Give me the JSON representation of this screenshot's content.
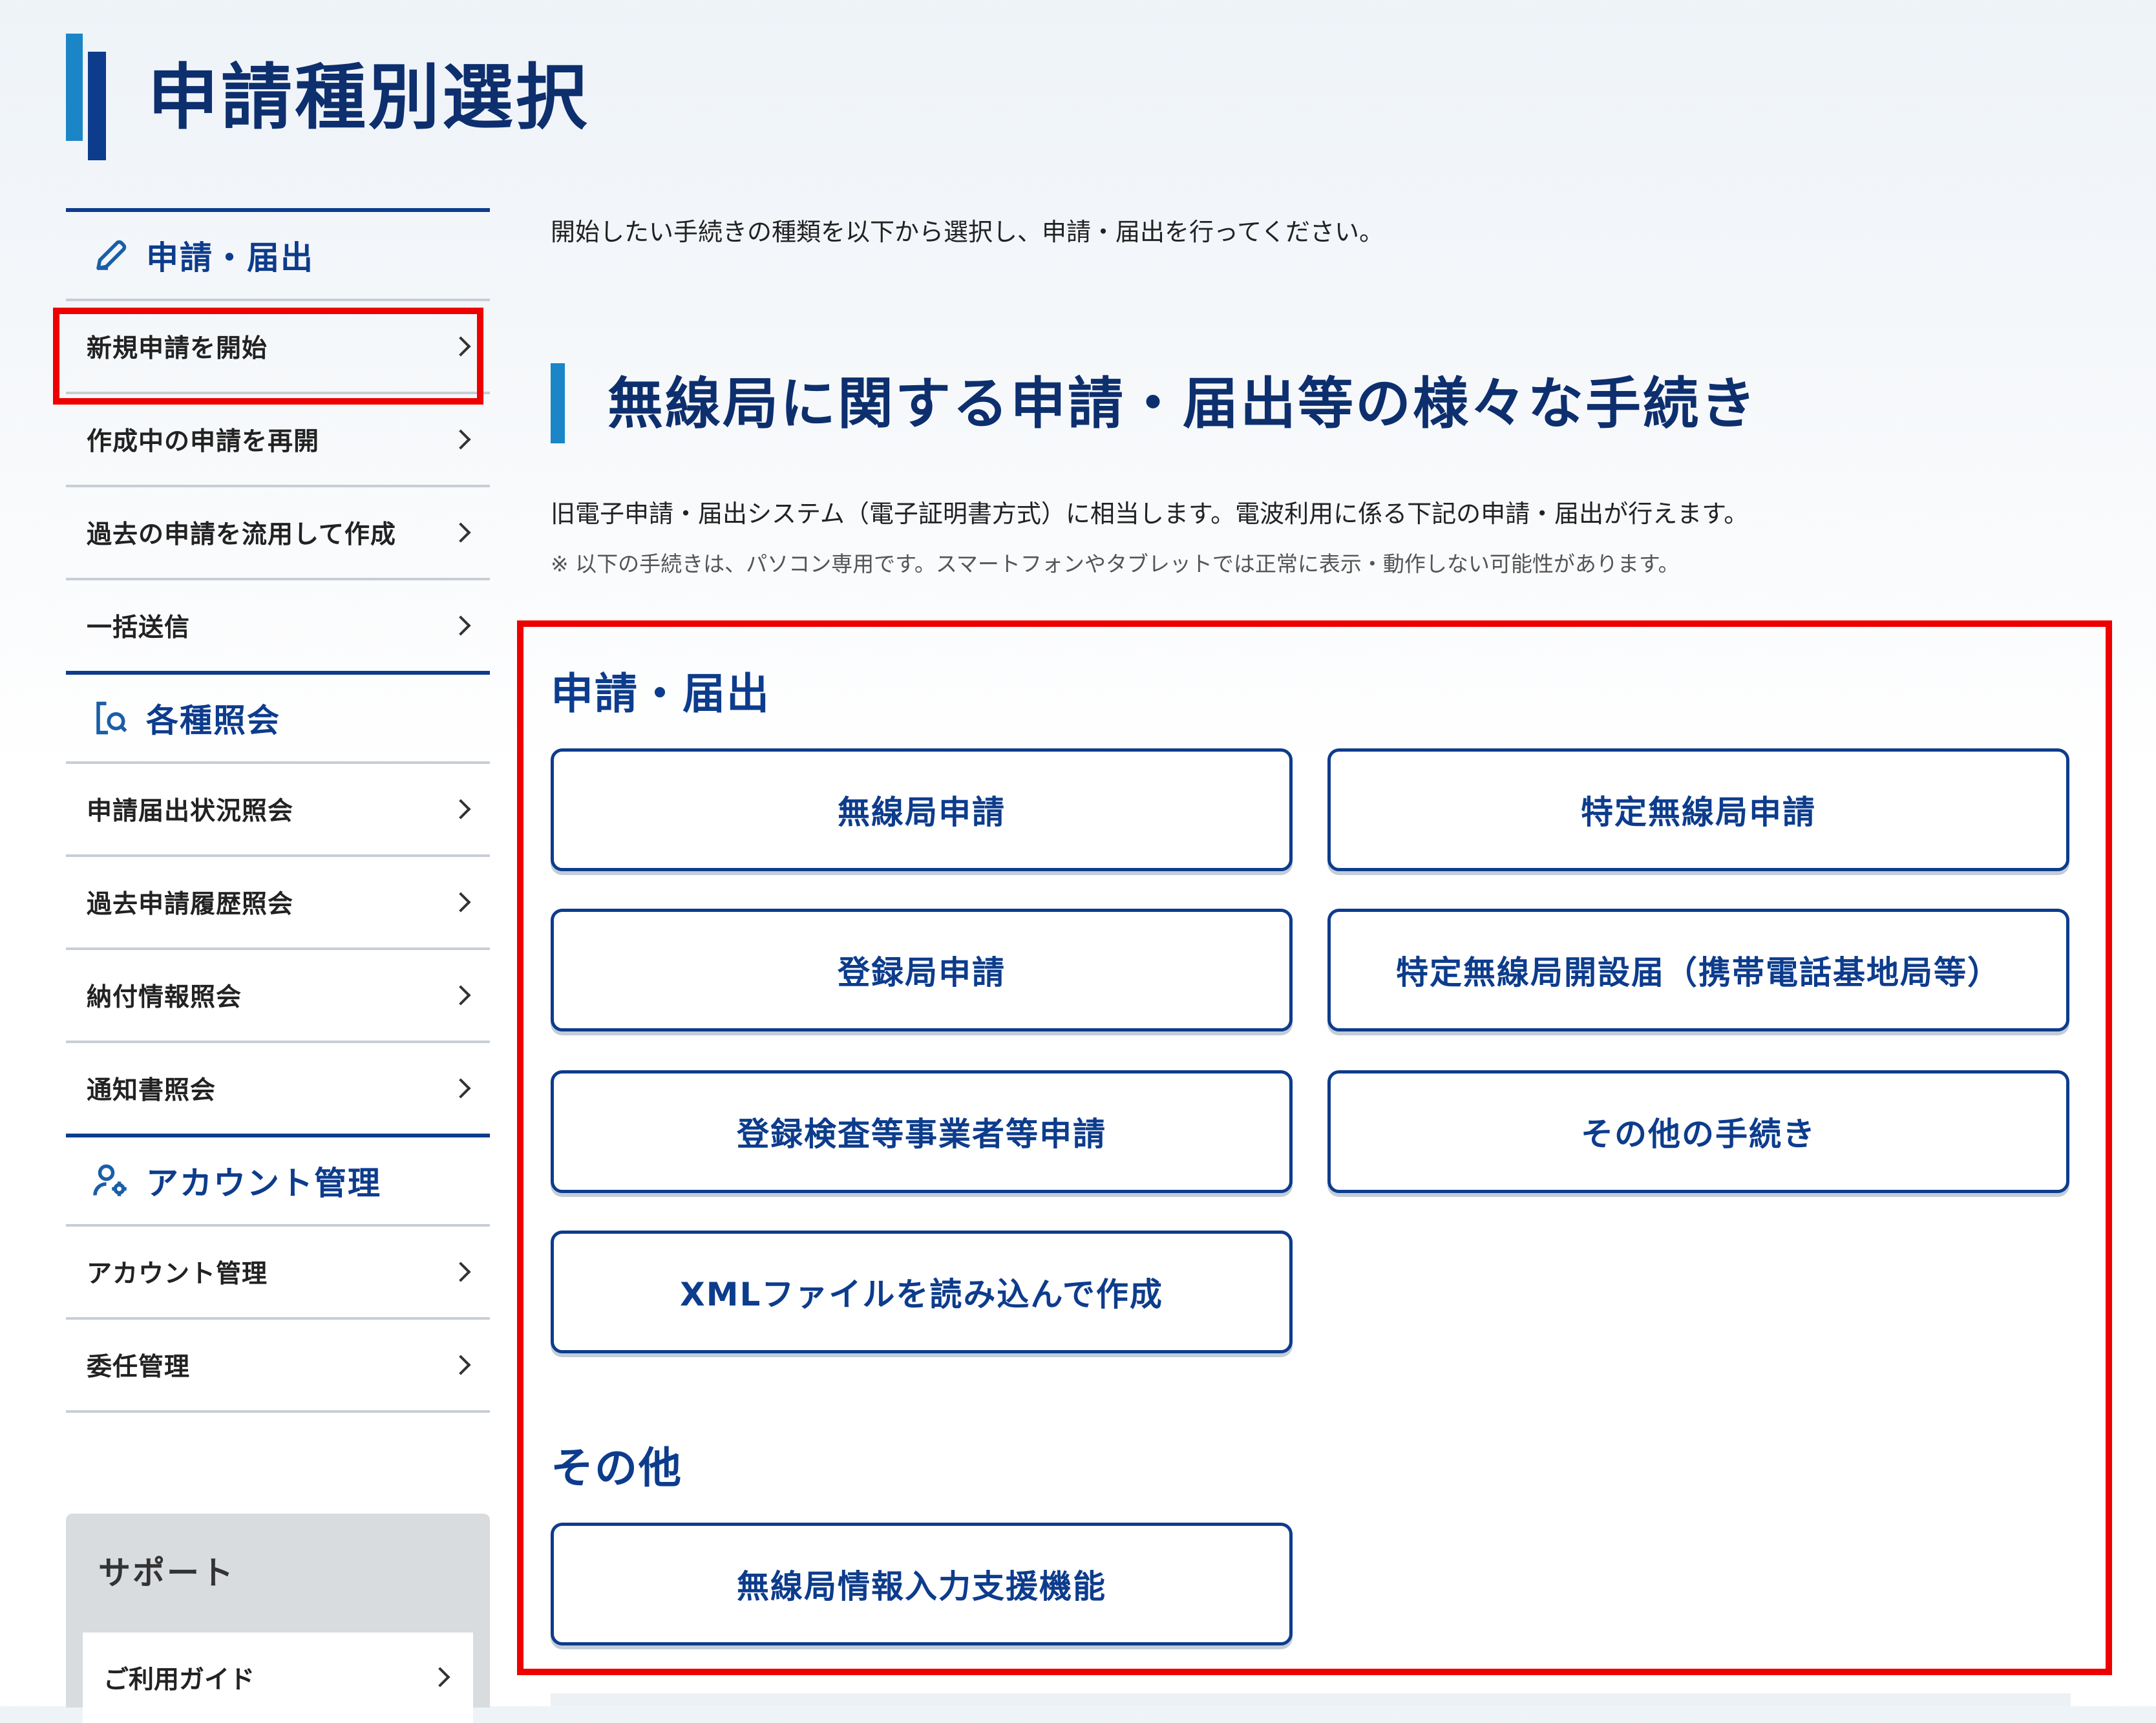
{
  "page_title": "申請種別選択",
  "sidebar": {
    "sections": [
      {
        "icon": "pencil-icon",
        "label": "申請・届出",
        "items": [
          "新規申請を開始",
          "作成中の申請を再開",
          "過去の申請を流用して作成",
          "一括送信"
        ]
      },
      {
        "icon": "document-search-icon",
        "label": "各種照会",
        "items": [
          "申請届出状況照会",
          "過去申請履歴照会",
          "納付情報照会",
          "通知書照会"
        ]
      },
      {
        "icon": "user-gear-icon",
        "label": "アカウント管理",
        "items": [
          "アカウント管理",
          "委任管理"
        ]
      }
    ],
    "support": {
      "label": "サポート",
      "item": "ご利用ガイド"
    }
  },
  "main": {
    "intro": "開始したい手続きの種類を以下から選択し、申請・届出を行ってください。",
    "heading": "無線局に関する申請・届出等の様々な手続き",
    "description": "旧電子申請・届出システム（電子証明書方式）に相当します。電波利用に係る下記の申請・届出が行えます。",
    "note": "※ 以下の手続きは、パソコン専用です。スマートフォンやタブレットでは正常に表示・動作しない可能性があります。",
    "groups": [
      {
        "title": "申請・届出",
        "buttons": [
          "無線局申請",
          "特定無線局申請",
          "登録局申請",
          "特定無線局開設届（携帯電話基地局等）",
          "登録検査等事業者等申請",
          "その他の手続き",
          "XMLファイルを読み込んで作成"
        ]
      },
      {
        "title": "その他",
        "buttons": [
          "無線局情報入力支援機能"
        ]
      }
    ]
  },
  "colors": {
    "accent": "#0d3c8c",
    "accent_light": "#1a86c7",
    "highlight": "#ee0000"
  }
}
